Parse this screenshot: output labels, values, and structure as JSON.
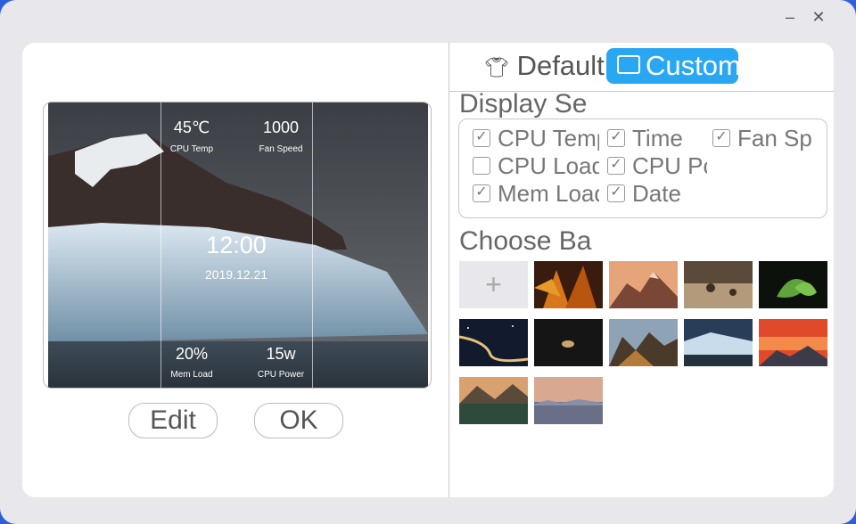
{
  "window": {
    "minimize_icon": "minimize-icon",
    "close_icon": "close-icon"
  },
  "preview": {
    "cpu_temp_value": "45℃",
    "cpu_temp_label": "CPU Temp",
    "fan_speed_value": "1000",
    "fan_speed_label": "Fan Speed",
    "clock": "12:00",
    "date": "2019.12.21",
    "mem_load_value": "20%",
    "mem_load_label": "Mem Load",
    "cpu_power_value": "15w",
    "cpu_power_label": "CPU Power"
  },
  "buttons": {
    "edit": "Edit",
    "ok": "OK"
  },
  "tabs": [
    {
      "label": "Default",
      "icon": "tshirt-icon",
      "selected": false
    },
    {
      "label": "Custom",
      "icon": "image-icon",
      "selected": true
    }
  ],
  "display_settings": {
    "title": "Display Se",
    "options": [
      {
        "label": "CPU Temp",
        "checked": true
      },
      {
        "label": "Time",
        "checked": true
      },
      {
        "label": "Fan Speed",
        "checked": true
      },
      {
        "label": "CPU Load",
        "checked": false
      },
      {
        "label": "CPU Power",
        "checked": true
      },
      {
        "label": "Mem Load",
        "checked": true
      },
      {
        "label": "Date",
        "checked": true
      }
    ]
  },
  "backgrounds": {
    "title": "Choose Ba",
    "add_label": "+",
    "thumbnails": [
      "leaves",
      "mountain-sunset",
      "desert",
      "green-plant",
      "road-night",
      "planet",
      "mountain-valley",
      "iceberg",
      "red-sky",
      "lake-mountain",
      "mist-peaks"
    ]
  },
  "colors": {
    "accent": "#2aa7f3"
  }
}
